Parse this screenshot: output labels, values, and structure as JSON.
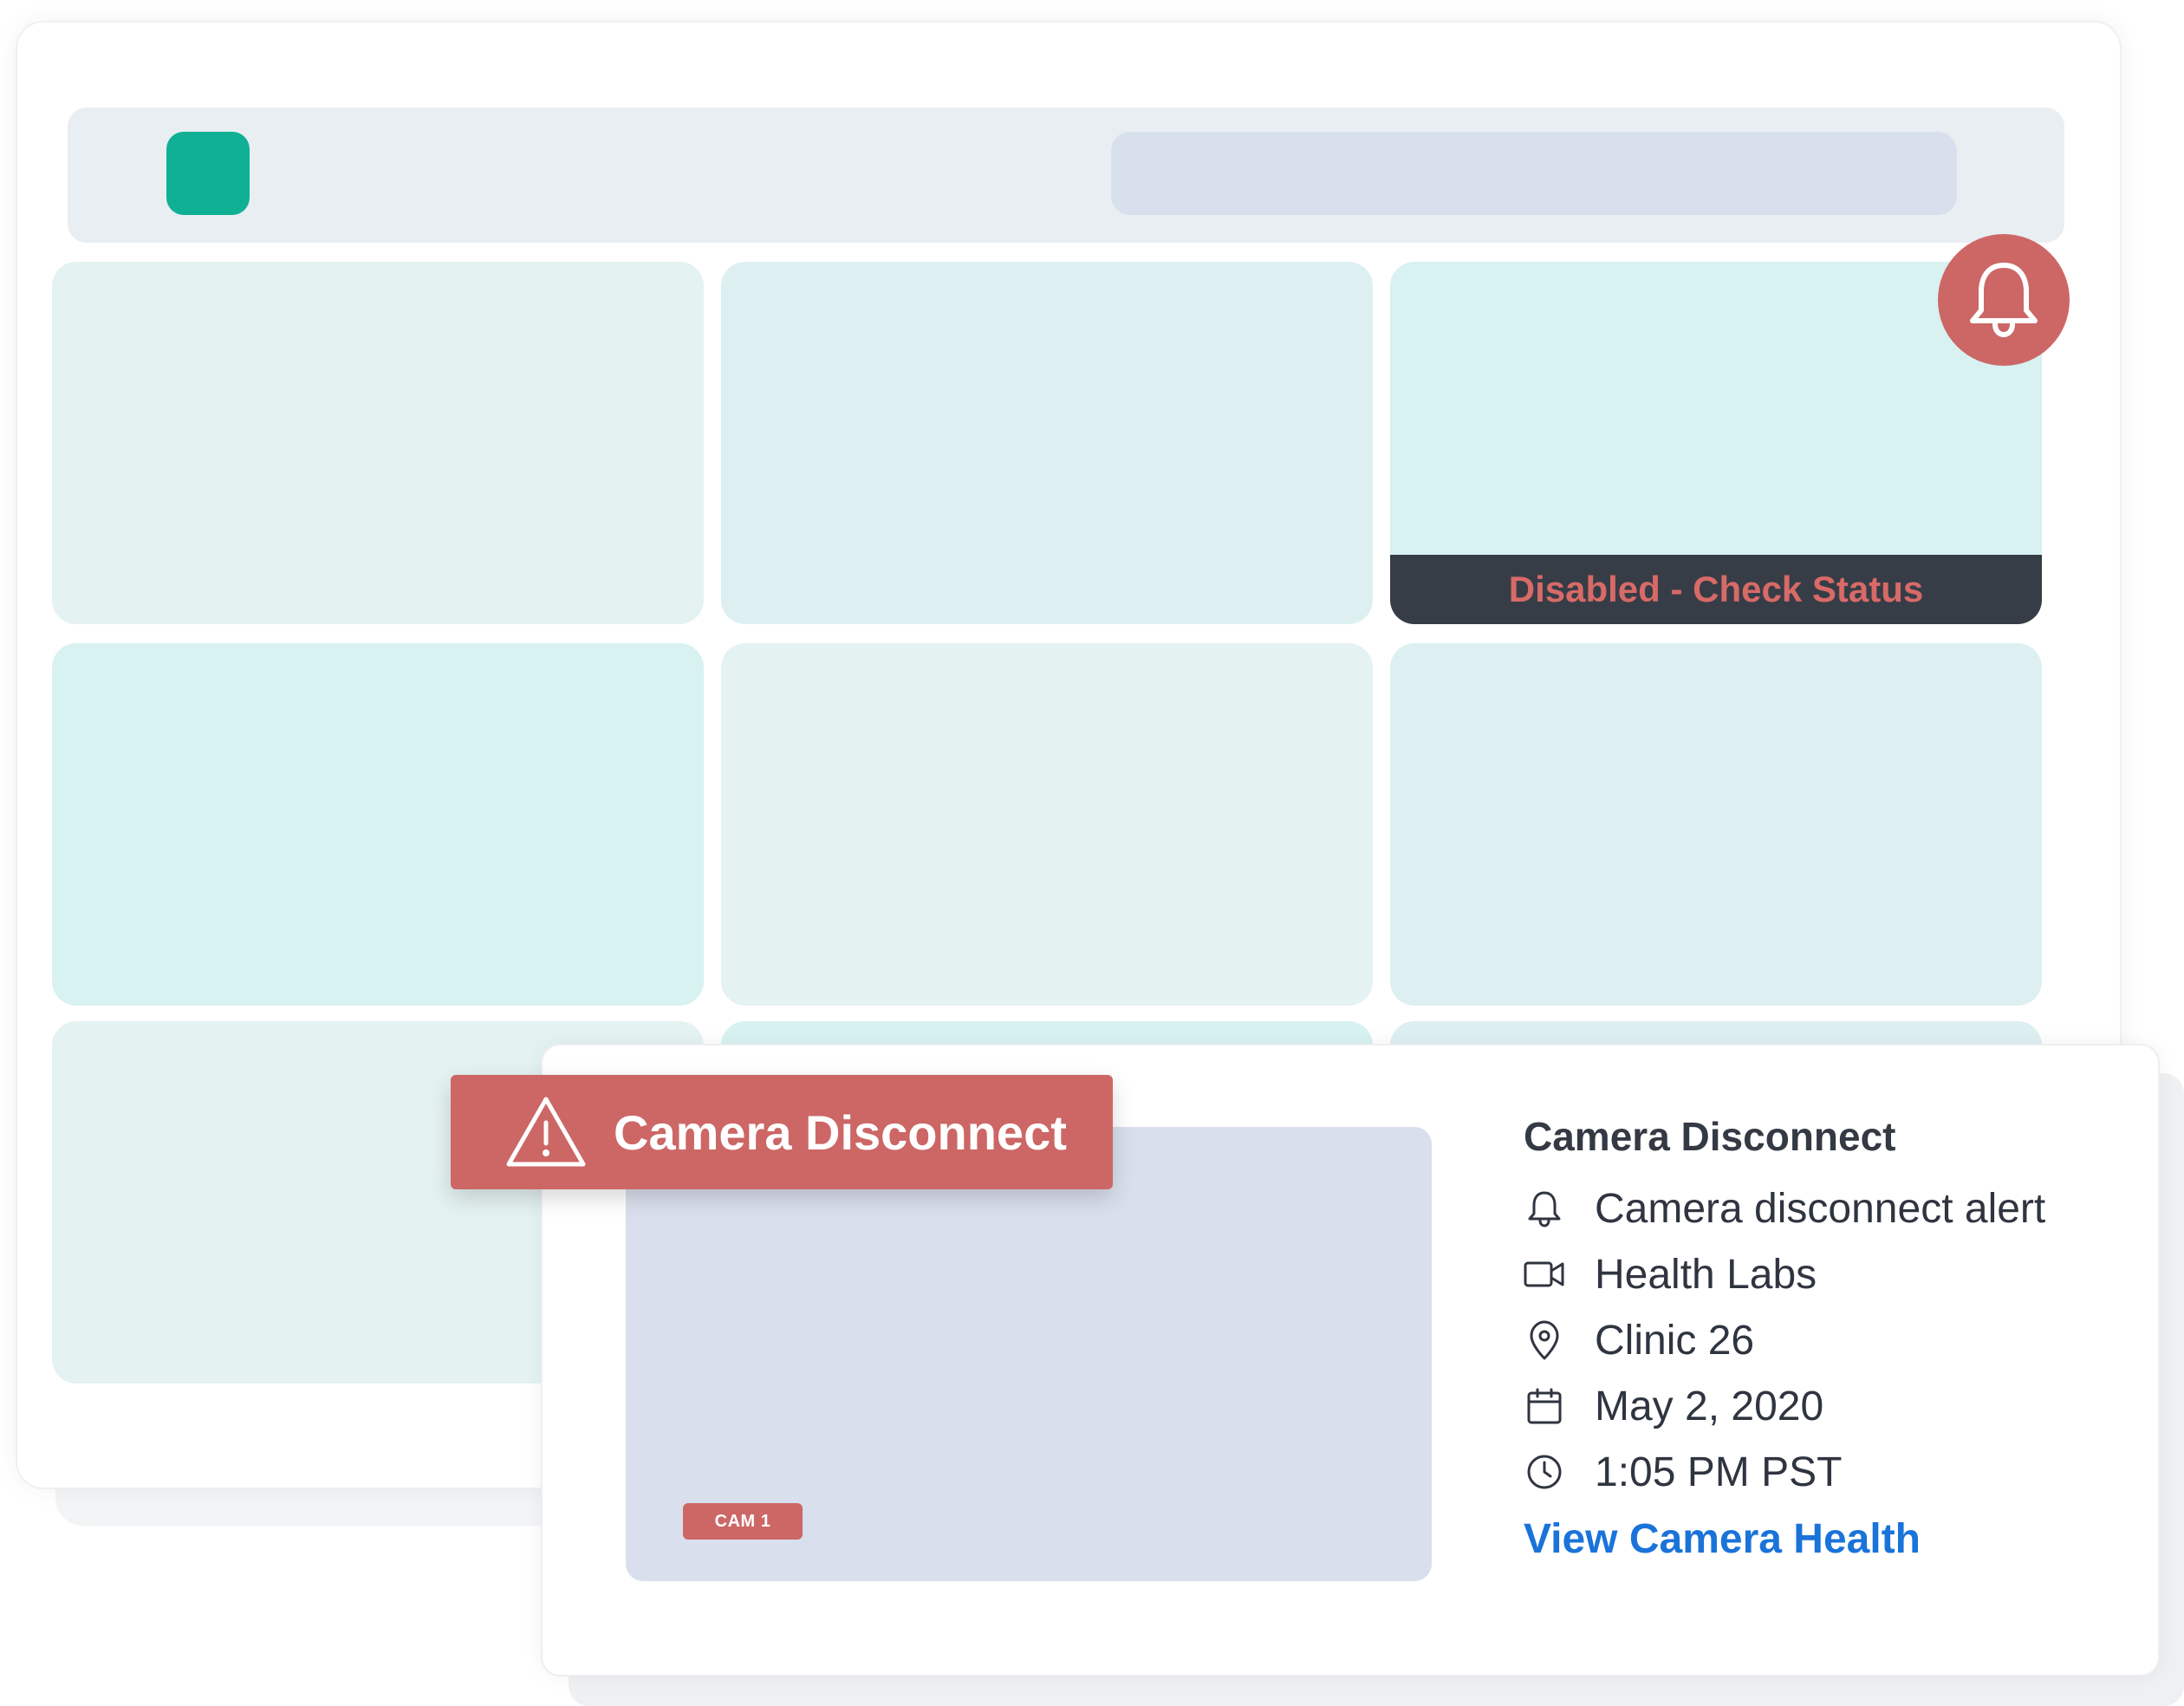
{
  "dashboard": {
    "tiles": [
      {
        "color": "#e4f2f1"
      },
      {
        "color": "#ddeff1"
      },
      {
        "color": "#d8f1f1",
        "status": "Disabled - Check Status"
      },
      {
        "color": "#d8f1f1"
      },
      {
        "color": "#e4f2f1"
      },
      {
        "color": "#ddeff1"
      },
      {
        "color": "#e4f2f1"
      },
      {
        "color": "#d8f1f1"
      },
      {
        "color": "#ddeff1"
      }
    ],
    "status_color": "#d86a67",
    "logo_color": "#0fb093"
  },
  "alert_banner": {
    "title": "Camera Disconnect",
    "icon": "warning-icon",
    "color": "#cc6766"
  },
  "alert_card": {
    "cam_label": "CAM 1",
    "title": "Camera Disconnect",
    "details": [
      {
        "icon": "bell-icon",
        "text": "Camera disconnect alert"
      },
      {
        "icon": "video-camera-icon",
        "text": "Health Labs"
      },
      {
        "icon": "location-pin-icon",
        "text": "Clinic 26"
      },
      {
        "icon": "calendar-icon",
        "text": "May 2, 2020"
      },
      {
        "icon": "clock-icon",
        "text": "1:05 PM PST"
      }
    ],
    "link_text": "View Camera Health",
    "link_color": "#1a73d9"
  }
}
